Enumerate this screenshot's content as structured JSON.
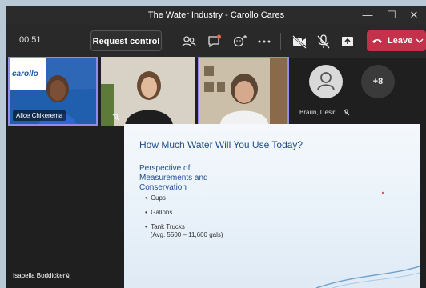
{
  "window": {
    "title": "The Water Industry - Carollo Cares",
    "minimize": "—",
    "maximize": "☐",
    "close": "✕"
  },
  "toolbar": {
    "timer": "00:51",
    "request_control": "Request control",
    "leave": "Leave"
  },
  "participants": {
    "tile1_name": "Alice Chikerema",
    "tile1_logo": "carollo",
    "overflow_name": "Braun, Desir...",
    "overflow_count": "+8",
    "bottom_name": "Isabella Boddicker"
  },
  "slide": {
    "title": "How Much Water Will You Use Today?",
    "subtitle": "Perspective of Measurements and Conservation",
    "bullets": [
      {
        "text": "Cups"
      },
      {
        "text": "Gallons"
      },
      {
        "text": "Tank Trucks",
        "sub": "(Avg. 5500 – 11,600 gals)"
      }
    ]
  },
  "colors": {
    "leave_red": "#c4314b",
    "active_border": "#8f8cf0",
    "slide_title": "#1f4e8c"
  }
}
